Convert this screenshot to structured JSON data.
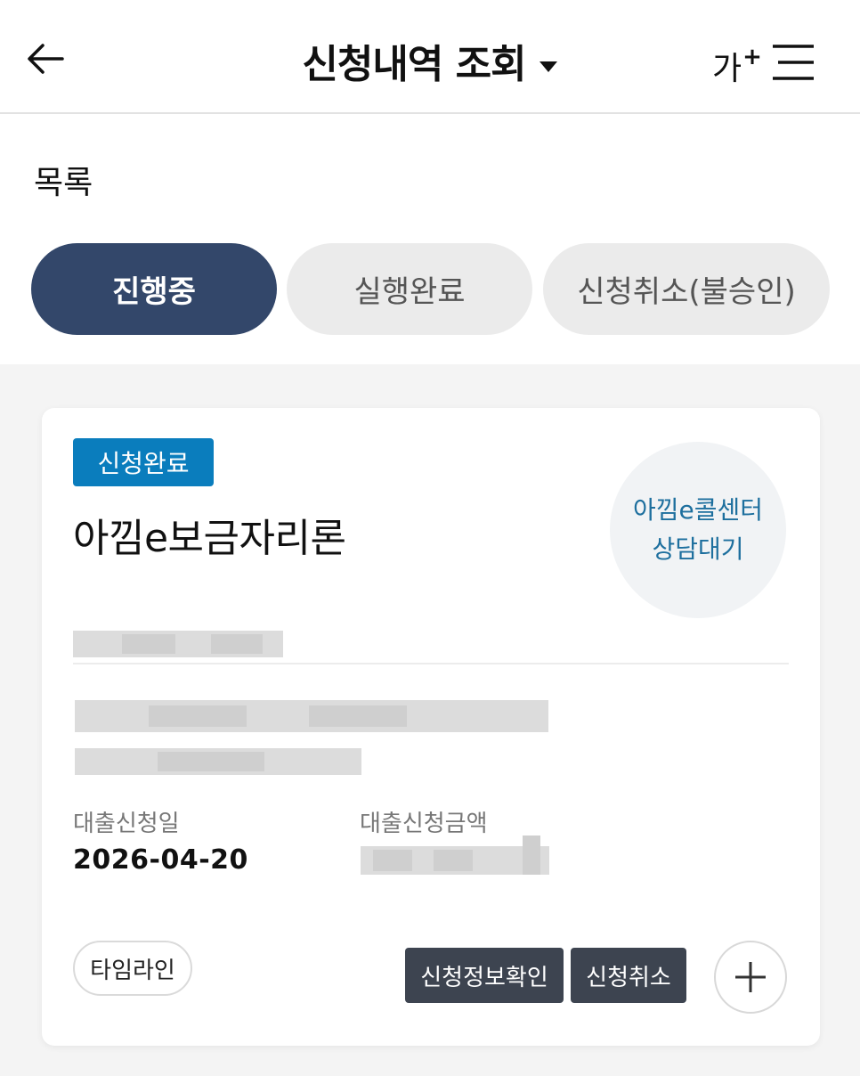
{
  "header": {
    "title": "신청내역 조회",
    "font_size_label": "가",
    "font_size_plus": "+"
  },
  "section": {
    "title": "목록"
  },
  "tabs": [
    {
      "label": "진행중",
      "active": true
    },
    {
      "label": "실행완료",
      "active": false
    },
    {
      "label": "신청취소(불승인)",
      "active": false
    }
  ],
  "card": {
    "status_badge": "신청완료",
    "product_name": "아낌e보금자리론",
    "call_center_line1": "아낌e콜센터",
    "call_center_line2": "상담대기",
    "application_date_label": "대출신청일",
    "application_date_value": "2026-04-20",
    "application_amount_label": "대출신청금액",
    "buttons": {
      "timeline": "타임라인",
      "view_info": "신청정보확인",
      "cancel": "신청취소"
    }
  },
  "colors": {
    "active_tab": "#33476a",
    "badge": "#0a7dbd",
    "call_center_text": "#1d6f9e",
    "dark_button": "#3d4450"
  }
}
